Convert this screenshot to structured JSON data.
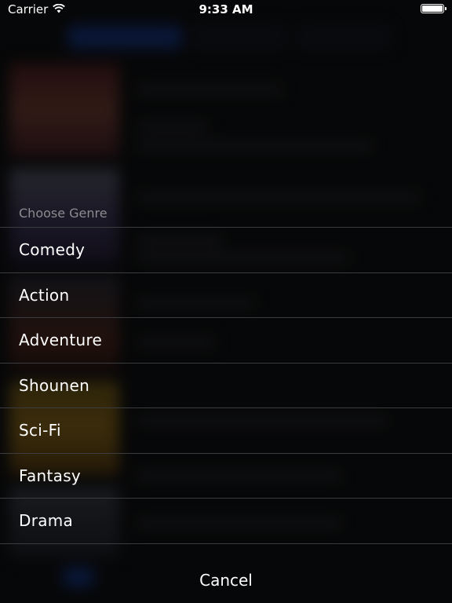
{
  "status_bar": {
    "carrier": "Carrier",
    "time": "9:33 AM",
    "wifi_icon": "wifi-icon",
    "battery_icon": "battery-icon",
    "battery_level": 1.0
  },
  "action_sheet": {
    "title": "Choose Genre",
    "options": [
      {
        "label": "Comedy"
      },
      {
        "label": "Action"
      },
      {
        "label": "Adventure"
      },
      {
        "label": "Shounen"
      },
      {
        "label": "Sci-Fi"
      },
      {
        "label": "Fantasy"
      },
      {
        "label": "Drama"
      }
    ],
    "cancel_label": "Cancel"
  },
  "colors": {
    "background": "#0f1012",
    "separator": "#3b3c40",
    "header_text": "#8a8c90",
    "item_text": "#ffffff",
    "accent": "#1a4fd1"
  }
}
